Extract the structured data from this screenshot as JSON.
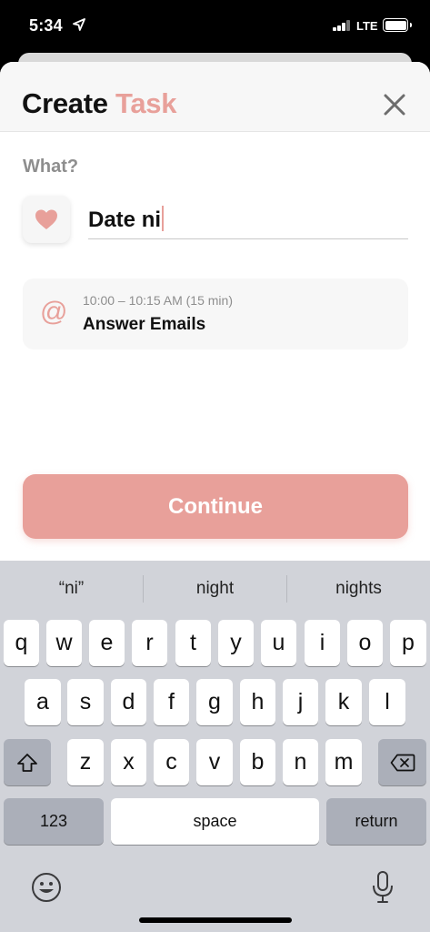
{
  "status_bar": {
    "time": "5:34",
    "network": "LTE"
  },
  "header": {
    "title_part1": "Create",
    "title_part2": "Task",
    "accent_color": "#e8a09a"
  },
  "form": {
    "what_label": "What?",
    "task_value": "Date ni",
    "category_icon": "heart-icon"
  },
  "suggestion": {
    "icon": "at-icon",
    "icon_glyph": "@",
    "time": "10:00 – 10:15 AM (15 min)",
    "title": "Answer Emails"
  },
  "continue_label": "Continue",
  "keyboard": {
    "predictions": [
      "“ni”",
      "night",
      "nights"
    ],
    "row1": [
      "q",
      "w",
      "e",
      "r",
      "t",
      "y",
      "u",
      "i",
      "o",
      "p"
    ],
    "row2": [
      "a",
      "s",
      "d",
      "f",
      "g",
      "h",
      "j",
      "k",
      "l"
    ],
    "row3": [
      "z",
      "x",
      "c",
      "v",
      "b",
      "n",
      "m"
    ],
    "numbers_label": "123",
    "space_label": "space",
    "return_label": "return"
  }
}
